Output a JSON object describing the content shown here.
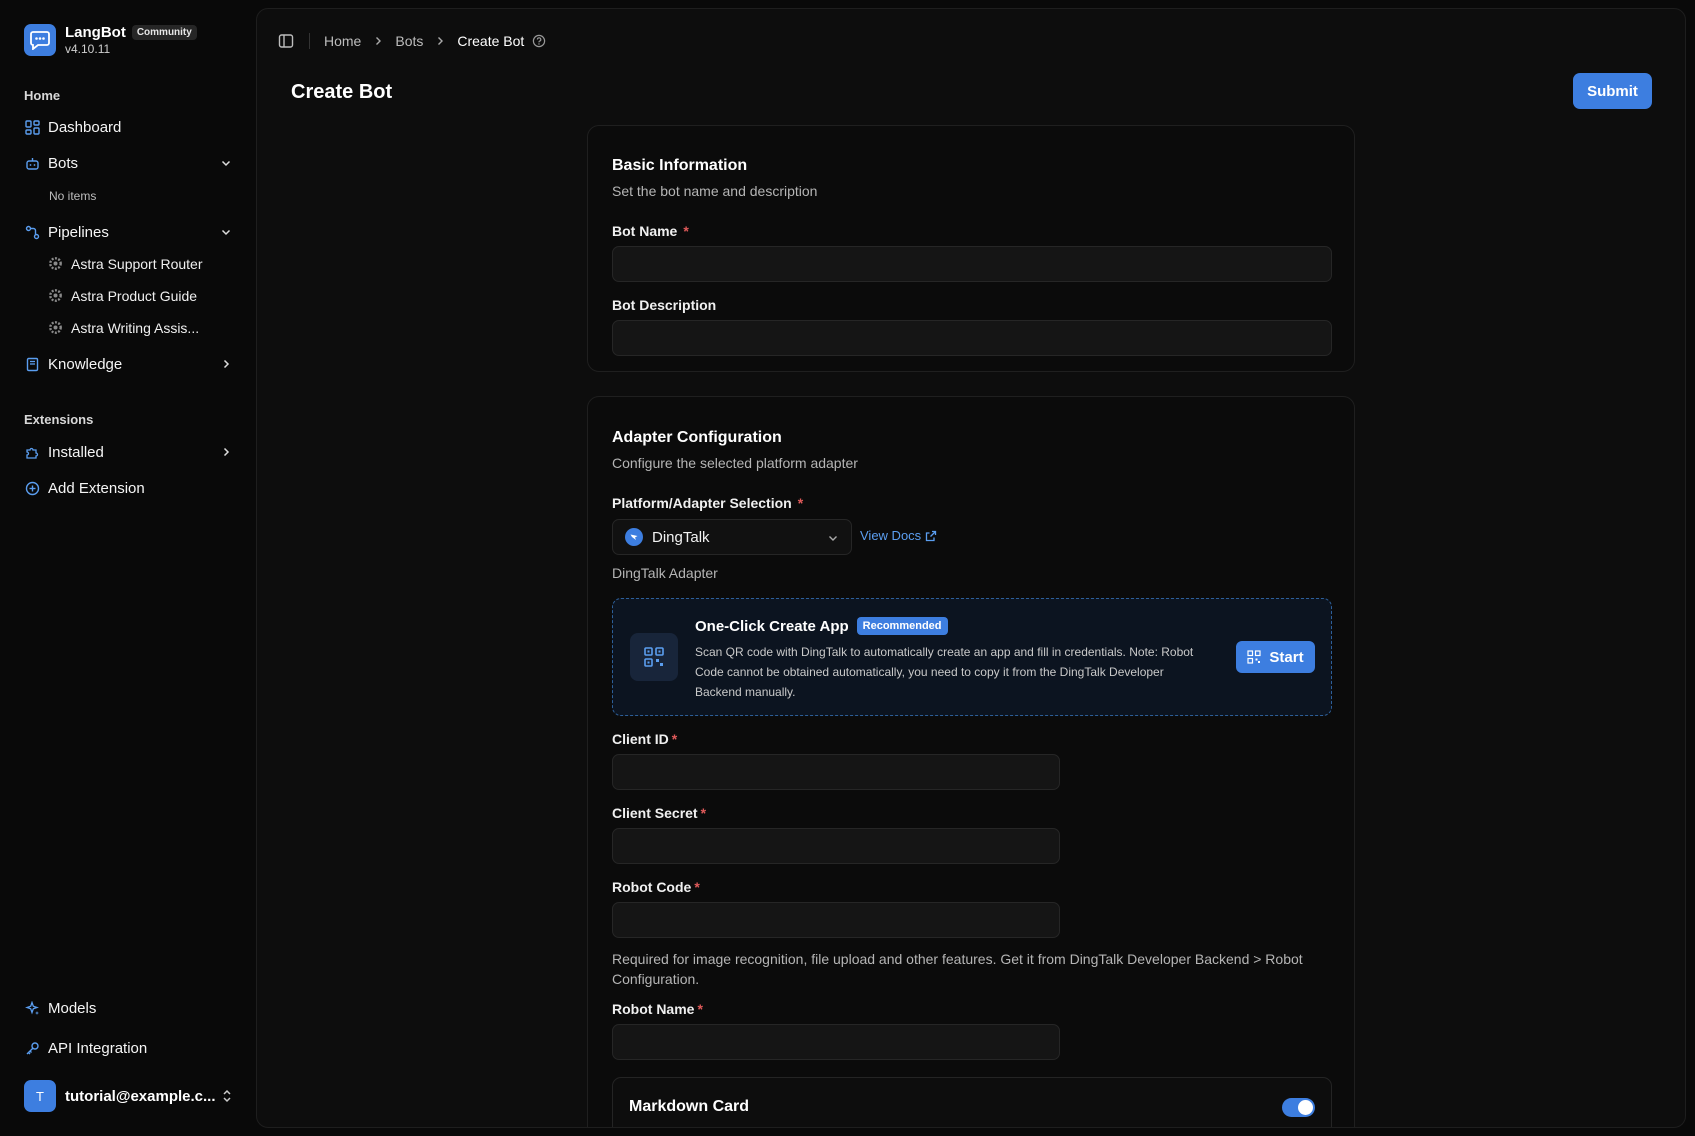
{
  "brand": {
    "name": "LangBot",
    "tag": "Community",
    "version": "v4.10.11"
  },
  "sidebar": {
    "group_home": "Home",
    "dashboard": "Dashboard",
    "bots": "Bots",
    "bots_empty": "No items",
    "pipelines": "Pipelines",
    "pipeline_items": [
      "Astra Support Router",
      "Astra Product Guide",
      "Astra Writing Assis..."
    ],
    "knowledge": "Knowledge",
    "group_extensions": "Extensions",
    "installed": "Installed",
    "add_extension": "Add Extension",
    "models": "Models",
    "api_integration": "API Integration",
    "user_initial": "T",
    "user_email": "tutorial@example.c..."
  },
  "breadcrumb": {
    "home": "Home",
    "bots": "Bots",
    "current": "Create Bot"
  },
  "page": {
    "title": "Create Bot",
    "submit": "Submit"
  },
  "basic": {
    "title": "Basic Information",
    "subtitle": "Set the bot name and description",
    "name_label": "Bot Name",
    "name_value": "",
    "desc_label": "Bot Description",
    "desc_value": "",
    "required_mark": "*"
  },
  "adapter": {
    "title": "Adapter Configuration",
    "subtitle": "Configure the selected platform adapter",
    "select_label": "Platform/Adapter Selection",
    "selected": "DingTalk",
    "view_docs": "View Docs",
    "adapter_desc": "DingTalk Adapter",
    "oneclick_title": "One-Click Create App",
    "oneclick_badge": "Recommended",
    "oneclick_desc": "Scan QR code with DingTalk to automatically create an app and fill in credentials. Note: Robot Code cannot be obtained automatically, you need to copy it from the DingTalk Developer Backend manually.",
    "start": "Start",
    "client_id_label": "Client ID",
    "client_secret_label": "Client Secret",
    "robot_code_label": "Robot Code",
    "robot_code_help": "Required for image recognition, file upload and other features. Get it from DingTalk Developer Backend > Robot Configuration.",
    "robot_name_label": "Robot Name",
    "markdown_card": "Markdown Card",
    "markdown_enabled": true
  },
  "colors": {
    "accent": "#3d7ee0",
    "required": "#e05a5a",
    "link": "#5b9ef0"
  },
  "icons": [
    "chat-logo-icon",
    "dashboard-icon",
    "bot-icon",
    "pipeline-icon",
    "gear-icon",
    "book-icon",
    "puzzle-icon",
    "plus-circle-icon",
    "sparkle-icon",
    "key-icon",
    "sidebar-toggle-icon",
    "chevron-right-icon",
    "chevron-down-icon",
    "help-circle-icon",
    "external-link-icon",
    "qr-code-icon",
    "chevrons-up-down-icon"
  ]
}
